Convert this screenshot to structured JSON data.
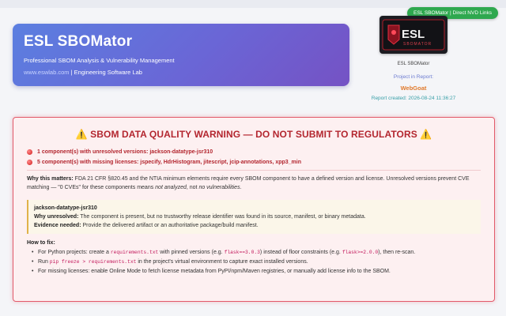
{
  "nav": {
    "nvd_badge": "ESL SBOMator | Direct NVD Links"
  },
  "header": {
    "title": "ESL SBOMator",
    "subtitle": "Professional SBOM Analysis & Vulnerability Management",
    "url": "www.eswlab.com",
    "org": " | Engineering Software Lab"
  },
  "brand": {
    "logo_text": "ESL",
    "logo_subtext": "SBOMATOR",
    "name": "ESL SBOMator",
    "project_label": "Project in Report:",
    "project_name": "WebGoat",
    "report_created": "Report created: 2026-08-24 11:36:27"
  },
  "warning": {
    "title": "SBOM DATA QUALITY WARNING — DO NOT SUBMIT TO REGULATORS",
    "issues": [
      "1 component(s) with unresolved versions: jackson-datatype-jsr310",
      "5 component(s) with missing licenses: jspecify, HdrHistogram, jitescript, jcip-annotations, xpp3_min"
    ],
    "why_label": "Why this matters:",
    "why_text_1": " FDA 21 CFR §820.45 and the NTIA minimum elements require every SBOM component to have a defined version and license. Unresolved versions prevent CVE matching — \"0 CVEs\" for these components means ",
    "why_em_1": "not analyzed",
    "why_text_2": ", not ",
    "why_em_2": "no vulnerabilities",
    "why_text_3": ".",
    "detail": {
      "component": "jackson-datatype-jsr310",
      "unresolved_label": "Why unresolved:",
      "unresolved_text": " The component is present, but no trustworthy release identifier was found in its source, manifest, or binary metadata.",
      "evidence_label": "Evidence needed:",
      "evidence_text": " Provide the delivered artifact or an authoritative package/build manifest."
    },
    "howto": {
      "label": "How to fix:",
      "item1_a": "For Python projects: create a ",
      "item1_code1": "requirements.txt",
      "item1_b": " with pinned versions (e.g. ",
      "item1_code2": "flask==3.0.3",
      "item1_c": ") instead of floor constraints (e.g. ",
      "item1_code3": "flask>=2.0.0",
      "item1_d": "), then re-scan.",
      "item2_a": "Run ",
      "item2_code": "pip freeze > requirements.txt",
      "item2_b": " in the project's virtual environment to capture exact installed versions.",
      "item3": "For missing licenses: enable Online Mode to fetch license metadata from PyPI/npm/Maven registries, or manually add license info to the SBOM."
    }
  },
  "colors": {
    "accent_green": "#2fa84f",
    "hero_gradient_start": "#5b7fe0",
    "hero_gradient_end": "#7552c4",
    "warning_red": "#b3262f",
    "project_orange": "#e07a2c"
  }
}
